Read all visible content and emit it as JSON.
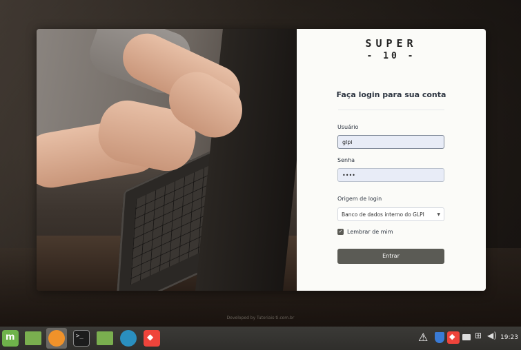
{
  "background": {
    "footer_note": "Developed by Tutoriais-ti.com.br"
  },
  "login": {
    "logo_line1": "SUPER",
    "logo_line2": "- 10 -",
    "heading": "Faça login para sua conta",
    "user_label": "Usuário",
    "user_value": "glpi",
    "password_label": "Senha",
    "password_value": "••••",
    "origin_label": "Origem de login",
    "origin_selected": "Banco de dados interno do GLPI",
    "remember_label": "Lembrar de mim",
    "remember_checked": true,
    "submit_label": "Entrar"
  },
  "taskbar": {
    "icons": [
      "mint-menu-icon",
      "folder-icon",
      "firefox-icon",
      "terminal-icon",
      "files-icon",
      "update-manager-icon",
      "anydesk-icon"
    ],
    "tray": [
      "warning-icon",
      "shield-icon",
      "anydesk-icon",
      "printer-icon",
      "network-icon",
      "volume-icon"
    ],
    "clock": "19:23"
  },
  "colors": {
    "button": "#5b5b55",
    "panel": "#fbfbf8",
    "field": "#e8ecf7",
    "taskbar": "#34332f"
  }
}
